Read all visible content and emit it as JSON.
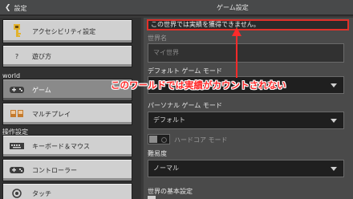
{
  "header": {
    "back_label": "設定",
    "title": "ゲーム設定"
  },
  "sidebar": {
    "items": [
      {
        "label": "アクセシビリティ設定",
        "icon": "key-icon"
      },
      {
        "label": "遊び方",
        "icon": "question-icon"
      }
    ],
    "world_header": "world",
    "world_items": [
      {
        "label": "ゲーム",
        "icon": "controller-icon",
        "selected": true
      },
      {
        "label": "マルチプレイ",
        "icon": "players-icon"
      }
    ],
    "controls_header": "操作設定",
    "controls_items": [
      {
        "label": "キーボード＆マウス",
        "icon": "keyboard-icon"
      },
      {
        "label": "コントローラー",
        "icon": "controller-icon"
      },
      {
        "label": "タッチ",
        "icon": "touch-icon"
      }
    ]
  },
  "content": {
    "notice": "この世界では実績を獲得できません。",
    "world_name_label": "世界名",
    "world_name_placeholder": "マイ世界",
    "default_game_mode_label": "デフォルト ゲーム モード",
    "personal_game_mode_label": "パーソナル ゲーム モード",
    "personal_game_mode_value": "デフォルト",
    "hardcore_label": "ハードコア モード",
    "difficulty_label": "難易度",
    "difficulty_value": "ノーマル",
    "world_basic_settings_label": "世界の基本設定"
  },
  "annotation": {
    "text": "このワールドでは実績がカウントされない",
    "color": "#ff2a2a"
  }
}
